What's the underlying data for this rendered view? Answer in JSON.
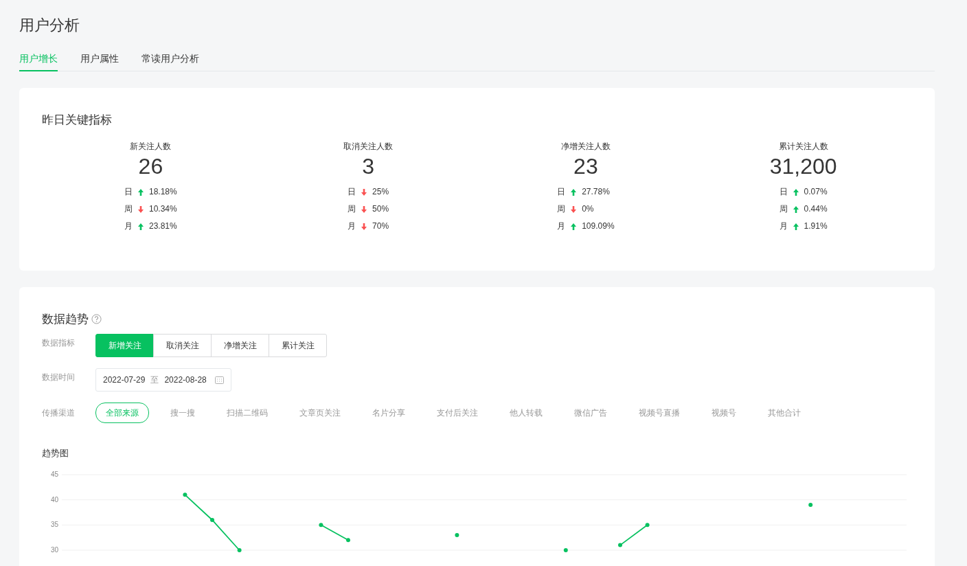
{
  "page_title": "用户分析",
  "tabs": [
    {
      "label": "用户增长",
      "selected": true
    },
    {
      "label": "用户属性",
      "selected": false
    },
    {
      "label": "常读用户分析",
      "selected": false
    }
  ],
  "key_metrics": {
    "title": "昨日关键指标",
    "metrics": [
      {
        "label": "新关注人数",
        "value": "26",
        "changes": [
          {
            "period": "日",
            "increase": true,
            "percent": "18.18%"
          },
          {
            "period": "周",
            "increase": false,
            "percent": "10.34%"
          },
          {
            "period": "月",
            "increase": true,
            "percent": "23.81%"
          }
        ]
      },
      {
        "label": "取消关注人数",
        "value": "3",
        "changes": [
          {
            "period": "日",
            "increase": false,
            "percent": "25%"
          },
          {
            "period": "周",
            "increase": false,
            "percent": "50%"
          },
          {
            "period": "月",
            "increase": false,
            "percent": "70%"
          }
        ]
      },
      {
        "label": "净增关注人数",
        "value": "23",
        "changes": [
          {
            "period": "日",
            "increase": true,
            "percent": "27.78%"
          },
          {
            "period": "周",
            "increase": false,
            "percent": "0%"
          },
          {
            "period": "月",
            "increase": true,
            "percent": "109.09%"
          }
        ]
      },
      {
        "label": "累计关注人数",
        "value": "31,200",
        "changes": [
          {
            "period": "日",
            "increase": true,
            "percent": "0.07%"
          },
          {
            "period": "周",
            "increase": true,
            "percent": "0.44%"
          },
          {
            "period": "月",
            "increase": true,
            "percent": "1.91%"
          }
        ]
      }
    ]
  },
  "trend": {
    "title": "数据趋势",
    "indicator_label": "数据指标",
    "indicators": [
      {
        "label": "新增关注",
        "selected": true
      },
      {
        "label": "取消关注",
        "selected": false
      },
      {
        "label": "净增关注",
        "selected": false
      },
      {
        "label": "累计关注",
        "selected": false
      }
    ],
    "time_label": "数据时间",
    "date_from": "2022-07-29",
    "date_sep": "至",
    "date_to": "2022-08-28",
    "channel_label": "传播渠道",
    "channels": [
      {
        "label": "全部来源",
        "selected": true
      },
      {
        "label": "搜一搜",
        "selected": false
      },
      {
        "label": "扫描二维码",
        "selected": false
      },
      {
        "label": "文章页关注",
        "selected": false
      },
      {
        "label": "名片分享",
        "selected": false
      },
      {
        "label": "支付后关注",
        "selected": false
      },
      {
        "label": "他人转载",
        "selected": false
      },
      {
        "label": "微信广告",
        "selected": false
      },
      {
        "label": "视频号直播",
        "selected": false
      },
      {
        "label": "视频号",
        "selected": false
      },
      {
        "label": "其他合计",
        "selected": false
      }
    ],
    "chart_title": "趋势图",
    "chart_data": {
      "type": "line",
      "ylim": [
        30,
        45
      ],
      "yticks": [
        30,
        35,
        40,
        45
      ],
      "grid": true,
      "series": [
        {
          "color": "#07c160",
          "marker": true,
          "values": [
            null,
            null,
            null,
            null,
            41,
            36,
            30,
            null,
            null,
            35,
            32,
            null,
            null,
            null,
            33,
            null,
            null,
            null,
            30,
            null,
            31,
            35,
            null,
            null,
            null,
            null,
            null,
            39,
            null,
            null,
            null
          ]
        }
      ]
    }
  }
}
